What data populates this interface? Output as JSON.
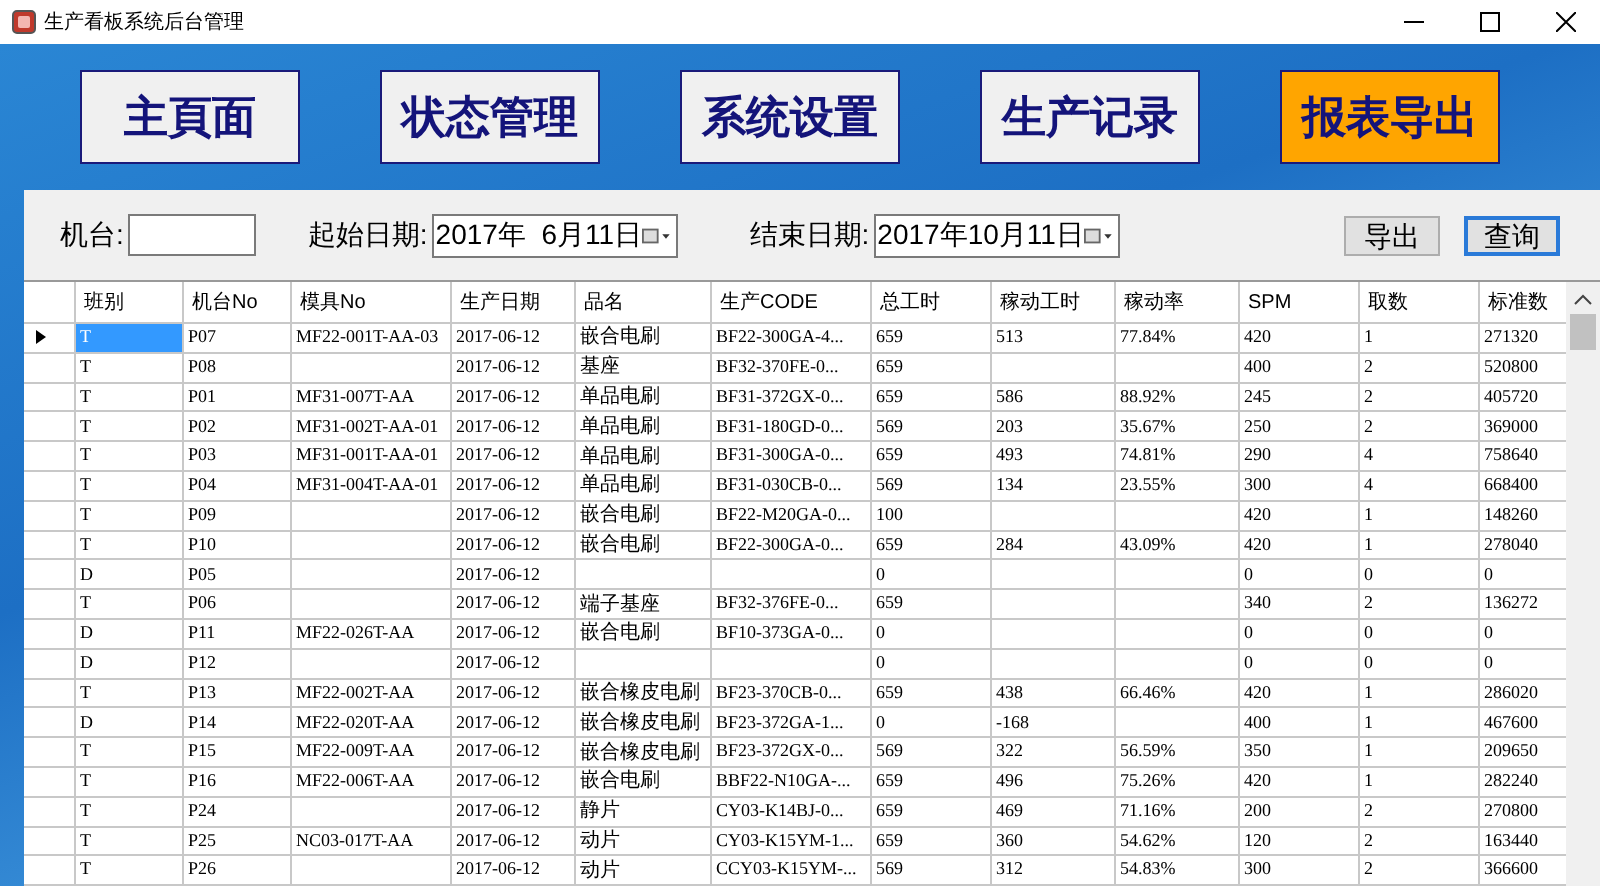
{
  "window": {
    "title": "生产看板系统后台管理"
  },
  "nav": [
    {
      "label": "主頁面",
      "selected": false
    },
    {
      "label": "状态管理",
      "selected": false
    },
    {
      "label": "系统设置",
      "selected": false
    },
    {
      "label": "生产记录",
      "selected": false
    },
    {
      "label": "报表导出",
      "selected": true
    }
  ],
  "filter": {
    "machine_label": "机台:",
    "start_label": "起始日期:",
    "start_date": "2017年  6月11日",
    "end_label": "结束日期:",
    "end_date": "2017年10月11日",
    "buttons": [
      {
        "label": "导出",
        "focused": false
      },
      {
        "label": "查询",
        "focused": true
      }
    ]
  },
  "table": {
    "columns": [
      "班别",
      "机台No",
      "模具No",
      "生产日期",
      "品名",
      "生产CODE",
      "总工时",
      "稼动工时",
      "稼动率",
      "SPM",
      "取数",
      "标准数"
    ],
    "rows": [
      {
        "selected": true,
        "cells": [
          "T",
          "P07",
          "MF22-001T-AA-03",
          "2017-06-12",
          "嵌合电刷",
          "BF22-300GA-4...",
          "659",
          "513",
          "77.84%",
          "420",
          "1",
          "271320"
        ]
      },
      {
        "selected": false,
        "cells": [
          "T",
          "P08",
          "",
          "2017-06-12",
          "基座",
          "BF32-370FE-0...",
          "659",
          "",
          "",
          "400",
          "2",
          "520800"
        ]
      },
      {
        "selected": false,
        "cells": [
          "T",
          "P01",
          "MF31-007T-AA",
          "2017-06-12",
          "单品电刷",
          "BF31-372GX-0...",
          "659",
          "586",
          "88.92%",
          "245",
          "2",
          "405720"
        ]
      },
      {
        "selected": false,
        "cells": [
          "T",
          "P02",
          "MF31-002T-AA-01",
          "2017-06-12",
          "单品电刷",
          "BF31-180GD-0...",
          "569",
          "203",
          "35.67%",
          "250",
          "2",
          "369000"
        ]
      },
      {
        "selected": false,
        "cells": [
          "T",
          "P03",
          "MF31-001T-AA-01",
          "2017-06-12",
          "单品电刷",
          "BF31-300GA-0...",
          "659",
          "493",
          "74.81%",
          "290",
          "4",
          "758640"
        ]
      },
      {
        "selected": false,
        "cells": [
          "T",
          "P04",
          "MF31-004T-AA-01",
          "2017-06-12",
          "单品电刷",
          "BF31-030CB-0...",
          "569",
          "134",
          "23.55%",
          "300",
          "4",
          "668400"
        ]
      },
      {
        "selected": false,
        "cells": [
          "T",
          "P09",
          "",
          "2017-06-12",
          "嵌合电刷",
          "BF22-M20GA-0...",
          "100",
          "",
          "",
          "420",
          "1",
          "148260"
        ]
      },
      {
        "selected": false,
        "cells": [
          "T",
          "P10",
          "",
          "2017-06-12",
          "嵌合电刷",
          "BF22-300GA-0...",
          "659",
          "284",
          "43.09%",
          "420",
          "1",
          "278040"
        ]
      },
      {
        "selected": false,
        "cells": [
          "D",
          "P05",
          "",
          "2017-06-12",
          "",
          "",
          "0",
          "",
          "",
          "0",
          "0",
          "0"
        ]
      },
      {
        "selected": false,
        "cells": [
          "T",
          "P06",
          "",
          "2017-06-12",
          "端子基座",
          "BF32-376FE-0...",
          "659",
          "",
          "",
          "340",
          "2",
          "136272"
        ]
      },
      {
        "selected": false,
        "cells": [
          "D",
          "P11",
          "MF22-026T-AA",
          "2017-06-12",
          "嵌合电刷",
          "BF10-373GA-0...",
          "0",
          "",
          "",
          "0",
          "0",
          "0"
        ]
      },
      {
        "selected": false,
        "cells": [
          "D",
          "P12",
          "",
          "2017-06-12",
          "",
          "",
          "0",
          "",
          "",
          "0",
          "0",
          "0"
        ]
      },
      {
        "selected": false,
        "cells": [
          "T",
          "P13",
          "MF22-002T-AA",
          "2017-06-12",
          "嵌合橡皮电刷",
          "BF23-370CB-0...",
          "659",
          "438",
          "66.46%",
          "420",
          "1",
          "286020"
        ]
      },
      {
        "selected": false,
        "cells": [
          "D",
          "P14",
          "MF22-020T-AA",
          "2017-06-12",
          "嵌合橡皮电刷",
          "BF23-372GA-1...",
          "0",
          "-168",
          "",
          "400",
          "1",
          "467600"
        ]
      },
      {
        "selected": false,
        "cells": [
          "T",
          "P15",
          "MF22-009T-AA",
          "2017-06-12",
          "嵌合橡皮电刷",
          "BF23-372GX-0...",
          "569",
          "322",
          "56.59%",
          "350",
          "1",
          "209650"
        ]
      },
      {
        "selected": false,
        "cells": [
          "T",
          "P16",
          "MF22-006T-AA",
          "2017-06-12",
          "嵌合电刷",
          "BBF22-N10GA-...",
          "659",
          "496",
          "75.26%",
          "420",
          "1",
          "282240"
        ]
      },
      {
        "selected": false,
        "cells": [
          "T",
          "P24",
          "",
          "2017-06-12",
          "静片",
          "CY03-K14BJ-0...",
          "659",
          "469",
          "71.16%",
          "200",
          "2",
          "270800"
        ]
      },
      {
        "selected": false,
        "cells": [
          "T",
          "P25",
          "NC03-017T-AA",
          "2017-06-12",
          "动片",
          "CY03-K15YM-1...",
          "659",
          "360",
          "54.62%",
          "120",
          "2",
          "163440"
        ]
      },
      {
        "selected": false,
        "cells": [
          "T",
          "P26",
          "",
          "2017-06-12",
          "动片",
          "CCY03-K15YM-...",
          "569",
          "312",
          "54.83%",
          "300",
          "2",
          "366600"
        ]
      }
    ]
  }
}
